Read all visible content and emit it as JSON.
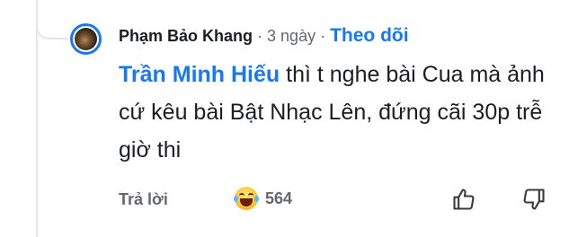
{
  "comment": {
    "author": "Phạm Bảo Khang",
    "separator": "·",
    "time": "3 ngày",
    "follow_label": "Theo dõi",
    "mention": "Trần Minh Hiếu",
    "text_after_mention": " thì t nghe bài Cua mà ảnh cứ kêu bài Bật Nhạc Lên, đứng cãi 30p trễ giờ thi",
    "avatar_icon": "user-avatar",
    "accent_color": "#1877f2"
  },
  "actions": {
    "reply_label": "Trả lời",
    "reaction_icon": "laughing-tears-emoji",
    "reaction_count": "564",
    "like_icon": "thumbs-up-icon",
    "dislike_icon": "thumbs-down-icon"
  }
}
